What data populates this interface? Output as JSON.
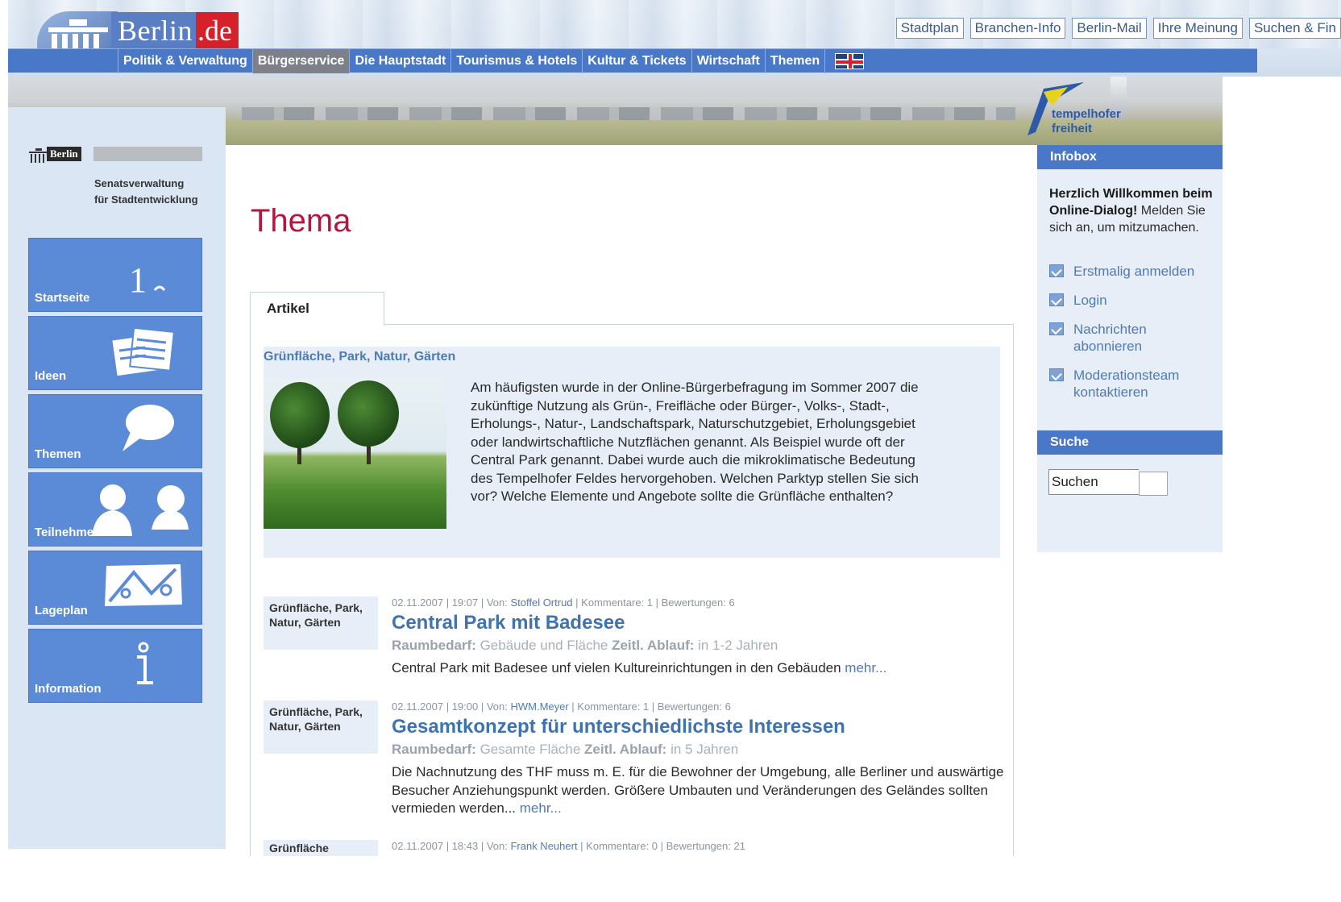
{
  "logo": {
    "name": "Berlin",
    "tld": ".de"
  },
  "toplinks": [
    "Stadtplan",
    "Branchen-Info",
    "Berlin-Mail",
    "Ihre Meinung",
    "Suchen & Fin"
  ],
  "nav": {
    "items": [
      "Politik & Verwaltung",
      "Bürgerservice",
      "Die Hauptstadt",
      "Tourismus & Hotels",
      "Kultur & Tickets",
      "Wirtschaft",
      "Themen"
    ],
    "active_index": 1
  },
  "banner": {
    "logo_line1": "tempelhofer",
    "logo_line2": "freiheit"
  },
  "sidebar": {
    "mini_logo": "Berlin",
    "senat_line1": "Senatsverwaltung",
    "senat_line2": "für Stadtentwicklung",
    "items": [
      {
        "label": "Startseite",
        "icon": "home-icon"
      },
      {
        "label": "Ideen",
        "icon": "documents-icon"
      },
      {
        "label": "Themen",
        "icon": "speech-bubble-icon"
      },
      {
        "label": "Teilnehmer",
        "icon": "people-icon"
      },
      {
        "label": "Lageplan",
        "icon": "map-icon"
      },
      {
        "label": "Information",
        "icon": "info-icon"
      }
    ]
  },
  "main": {
    "title": "Thema",
    "tab": "Artikel",
    "intro": {
      "category": "Grünfläche, Park, Natur, Gärten",
      "text": "Am häufigsten wurde in der Online-Bürgerbefragung im Sommer 2007 die zukünftige Nutzung als Grün-, Freifläche oder Bürger-, Volks-, Stadt-, Erholungs-, Natur-, Landschaftspark, Naturschutzgebiet, Erholungsgebiet oder landwirtschaftliche Nutzflächen genannt. Als Beispiel wurde oft der Central Park genannt. Dabei wurde auch die mikroklimatische Bedeutung des Tempelhofer Feldes hervorgehoben. Welchen Parktyp stellen Sie sich vor? Welche Elemente und Angebote sollte die Grünfläche enthalten?"
    },
    "entries": [
      {
        "tag": "Grünfläche, Park, Natur, Gärten",
        "meta_pre": "02.11.2007 | 19:07 | Von: ",
        "author": "Stoffel Ortrud",
        "meta_post": " | Kommentare: 1 | Bewertungen: 6",
        "title": "Central Park mit Badesee",
        "room_label": "Raumbedarf:",
        "room_value": " Gebäude und Fläche ",
        "time_label": "Zeitl. Ablauf:",
        "time_value": " in 1-2 Jahren",
        "desc": "Central Park mit Badesee unf vielen Kultureinrichtungen in den Gebäuden ",
        "more": "mehr..."
      },
      {
        "tag": "Grünfläche, Park, Natur, Gärten",
        "meta_pre": "02.11.2007 | 19:00 | Von: ",
        "author": "HWM.Meyer",
        "meta_post": " | Kommentare: 1 | Bewertungen: 6",
        "title": "Gesamtkonzept für unterschiedlichste Interessen",
        "room_label": "Raumbedarf:",
        "room_value": " Gesamte Fläche ",
        "time_label": "Zeitl. Ablauf:",
        "time_value": " in 5 Jahren",
        "desc": "Die Nachnutzung des THF muss m. E. für die Bewohner der Umgebung, alle Berliner und auswärtige Besucher Anziehungspunkt werden. Größere Umbauten und Veränderungen des Geländes sollten vermieden werden... ",
        "more": "mehr..."
      },
      {
        "tag": "Grünfläche",
        "meta_pre": "02.11.2007 | 18:43 | Von: ",
        "author": "Frank Neuhert",
        "meta_post": " | Kommentare: 0 | Bewertungen: 21"
      }
    ]
  },
  "infobox": {
    "title": "Infobox",
    "welcome_bold": "Herzlich Willkommen beim Online-Dialog!",
    "welcome_text": " Melden Sie sich an, um mitzumachen.",
    "links": [
      "Erstmalig anmelden",
      "Login",
      "Nachrichten abonnieren",
      "Moderationsteam kontaktieren"
    ],
    "search_title": "Suche",
    "search_value": "Suchen"
  },
  "colors": {
    "nav_blue": "#4a78c9",
    "side_blue": "#5b8bd6",
    "title_red": "#b3173f",
    "link_blue": "#4e7bb5"
  }
}
